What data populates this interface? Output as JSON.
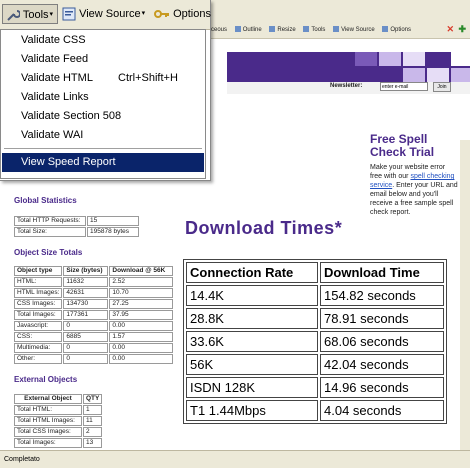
{
  "browser_toolbar": {
    "tools_label": "Tools",
    "view_source_label": "View Source",
    "options_label": "Options"
  },
  "tools_menu": {
    "items": [
      {
        "label": "Validate CSS"
      },
      {
        "label": "Validate Feed"
      },
      {
        "label": "Validate HTML",
        "shortcut": "Ctrl+Shift+H"
      },
      {
        "label": "Validate Links"
      },
      {
        "label": "Validate Section 508"
      },
      {
        "label": "Validate WAI"
      }
    ],
    "highlighted_item": "View Speed Report"
  },
  "background_toolbar": {
    "items": [
      "ceous",
      "Outline",
      "Resize",
      "Tools",
      "View Source",
      "Options"
    ]
  },
  "newsletter": {
    "label": "Newsletter:",
    "placeholder": "enter e-mail",
    "join_label": "Join"
  },
  "promo": {
    "title": "Free Spell Check Trial",
    "body_before": "Make your website error free with our",
    "link": "spell checking service",
    "body_after": ". Enter your URL and email below and you'll receive a free sample spell check report."
  },
  "global_statistics": {
    "heading": "Global Statistics",
    "rows": [
      [
        "Total HTTP Requests:",
        "15"
      ],
      [
        "Total Size:",
        "195878 bytes"
      ]
    ]
  },
  "object_size_totals": {
    "heading": "Object Size Totals",
    "headers": [
      "Object type",
      "Size (bytes)",
      "Download @ 56K"
    ],
    "rows": [
      [
        "HTML:",
        "11632",
        "2.52"
      ],
      [
        "HTML Images:",
        "42631",
        "10.70"
      ],
      [
        "CSS Images:",
        "134730",
        "27.25"
      ],
      [
        "Total Images:",
        "177361",
        "37.95"
      ],
      [
        "Javascript:",
        "0",
        "0.00"
      ],
      [
        "CSS:",
        "6885",
        "1.57"
      ],
      [
        "Multimedia:",
        "0",
        "0.00"
      ],
      [
        "Other:",
        "0",
        "0.00"
      ]
    ]
  },
  "external_objects": {
    "heading": "External Objects",
    "headers": [
      "External Object",
      "QTY"
    ],
    "rows": [
      [
        "Total HTML:",
        "1"
      ],
      [
        "Total HTML Images:",
        "11"
      ],
      [
        "Total CSS Images:",
        "2"
      ],
      [
        "Total Images:",
        "13"
      ]
    ]
  },
  "download_times": {
    "title": "Download Times*",
    "headers": [
      "Connection Rate",
      "Download Time"
    ],
    "rows": [
      [
        "14.4K",
        "154.82 seconds"
      ],
      [
        "28.8K",
        "78.91 seconds"
      ],
      [
        "33.6K",
        "68.06 seconds"
      ],
      [
        "56K",
        "42.04 seconds"
      ],
      [
        "ISDN 128K",
        "14.96 seconds"
      ],
      [
        "T1 1.44Mbps",
        "4.04 seconds"
      ]
    ]
  },
  "status_bar": {
    "text": "Completato"
  },
  "colors": {
    "accent_purple": "#4a2a8a",
    "menu_highlight": "#0a246a",
    "chrome": "#ece9d8"
  }
}
